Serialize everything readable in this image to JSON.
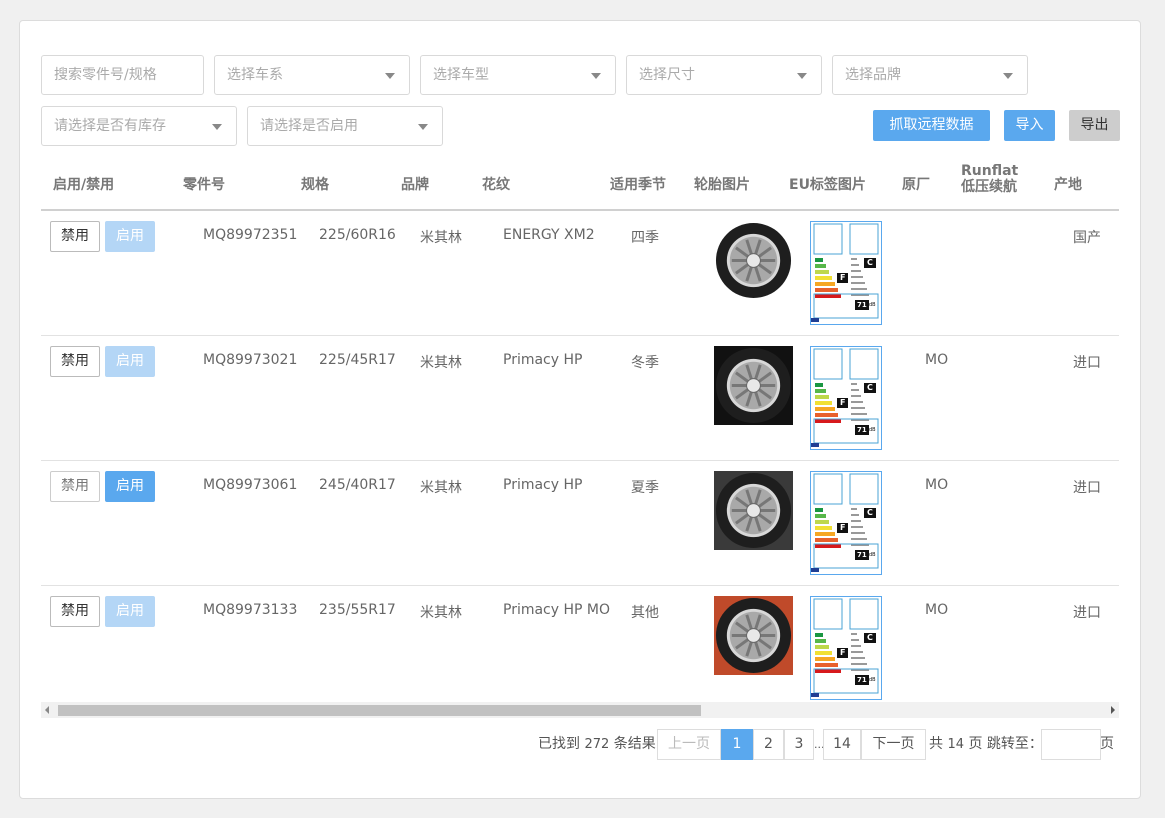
{
  "filters": {
    "search_placeholder": "搜索零件号/规格",
    "series": "选择车系",
    "model": "选择车型",
    "size": "选择尺寸",
    "brand": "选择品牌",
    "stock": "请选择是否有库存",
    "enabled": "请选择是否启用"
  },
  "actions": {
    "fetch_remote": "抓取远程数据",
    "import": "导入",
    "export": "导出"
  },
  "table": {
    "headers": {
      "toggle": "启用/禁用",
      "part_no": "零件号",
      "spec": "规格",
      "brand": "品牌",
      "pattern": "花纹",
      "season": "适用季节",
      "tire_image": "轮胎图片",
      "eu_image": "EU标签图片",
      "oem": "原厂",
      "runflat_1": "Runflat",
      "runflat_2": "低压续航",
      "origin": "产地"
    },
    "disable_label": "禁用",
    "enable_label": "启用",
    "rows": [
      {
        "part_no": "MQ89972351",
        "spec": "225/60R16",
        "brand": "米其林",
        "pattern": "ENERGY XM2",
        "season": "四季",
        "oem": "",
        "runflat": "",
        "origin": "国产",
        "enabled": false
      },
      {
        "part_no": "MQ89973021",
        "spec": "225/45R17",
        "brand": "米其林",
        "pattern": "Primacy HP",
        "season": "冬季",
        "oem": "MO",
        "runflat": "",
        "origin": "进口",
        "enabled": false
      },
      {
        "part_no": "MQ89973061",
        "spec": "245/40R17",
        "brand": "米其林",
        "pattern": "Primacy HP",
        "season": "夏季",
        "oem": "MO",
        "runflat": "",
        "origin": "进口",
        "enabled": true
      },
      {
        "part_no": "MQ89973133",
        "spec": "235/55R17",
        "brand": "米其林",
        "pattern": "Primacy HP MO",
        "season": "其他",
        "oem": "MO",
        "runflat": "",
        "origin": "进口",
        "enabled": false
      }
    ]
  },
  "eu_label": {
    "grade_wet": "C",
    "grade_fuel": "F",
    "noise": "71",
    "noise_unit": "dB"
  },
  "pagination": {
    "found_prefix": "已找到",
    "total": "272",
    "found_suffix": "条结果",
    "prev": "上一页",
    "pages": [
      "1",
      "2",
      "3"
    ],
    "ellipsis": "...",
    "last": "14",
    "next": "下一页",
    "total_pages_prefix": "共",
    "total_pages": "14",
    "total_pages_suffix": "页 跳转至：",
    "page_suffix": "页"
  },
  "colors": {
    "accent": "#5aa8ee",
    "accent_light": "#b4d6f6"
  }
}
